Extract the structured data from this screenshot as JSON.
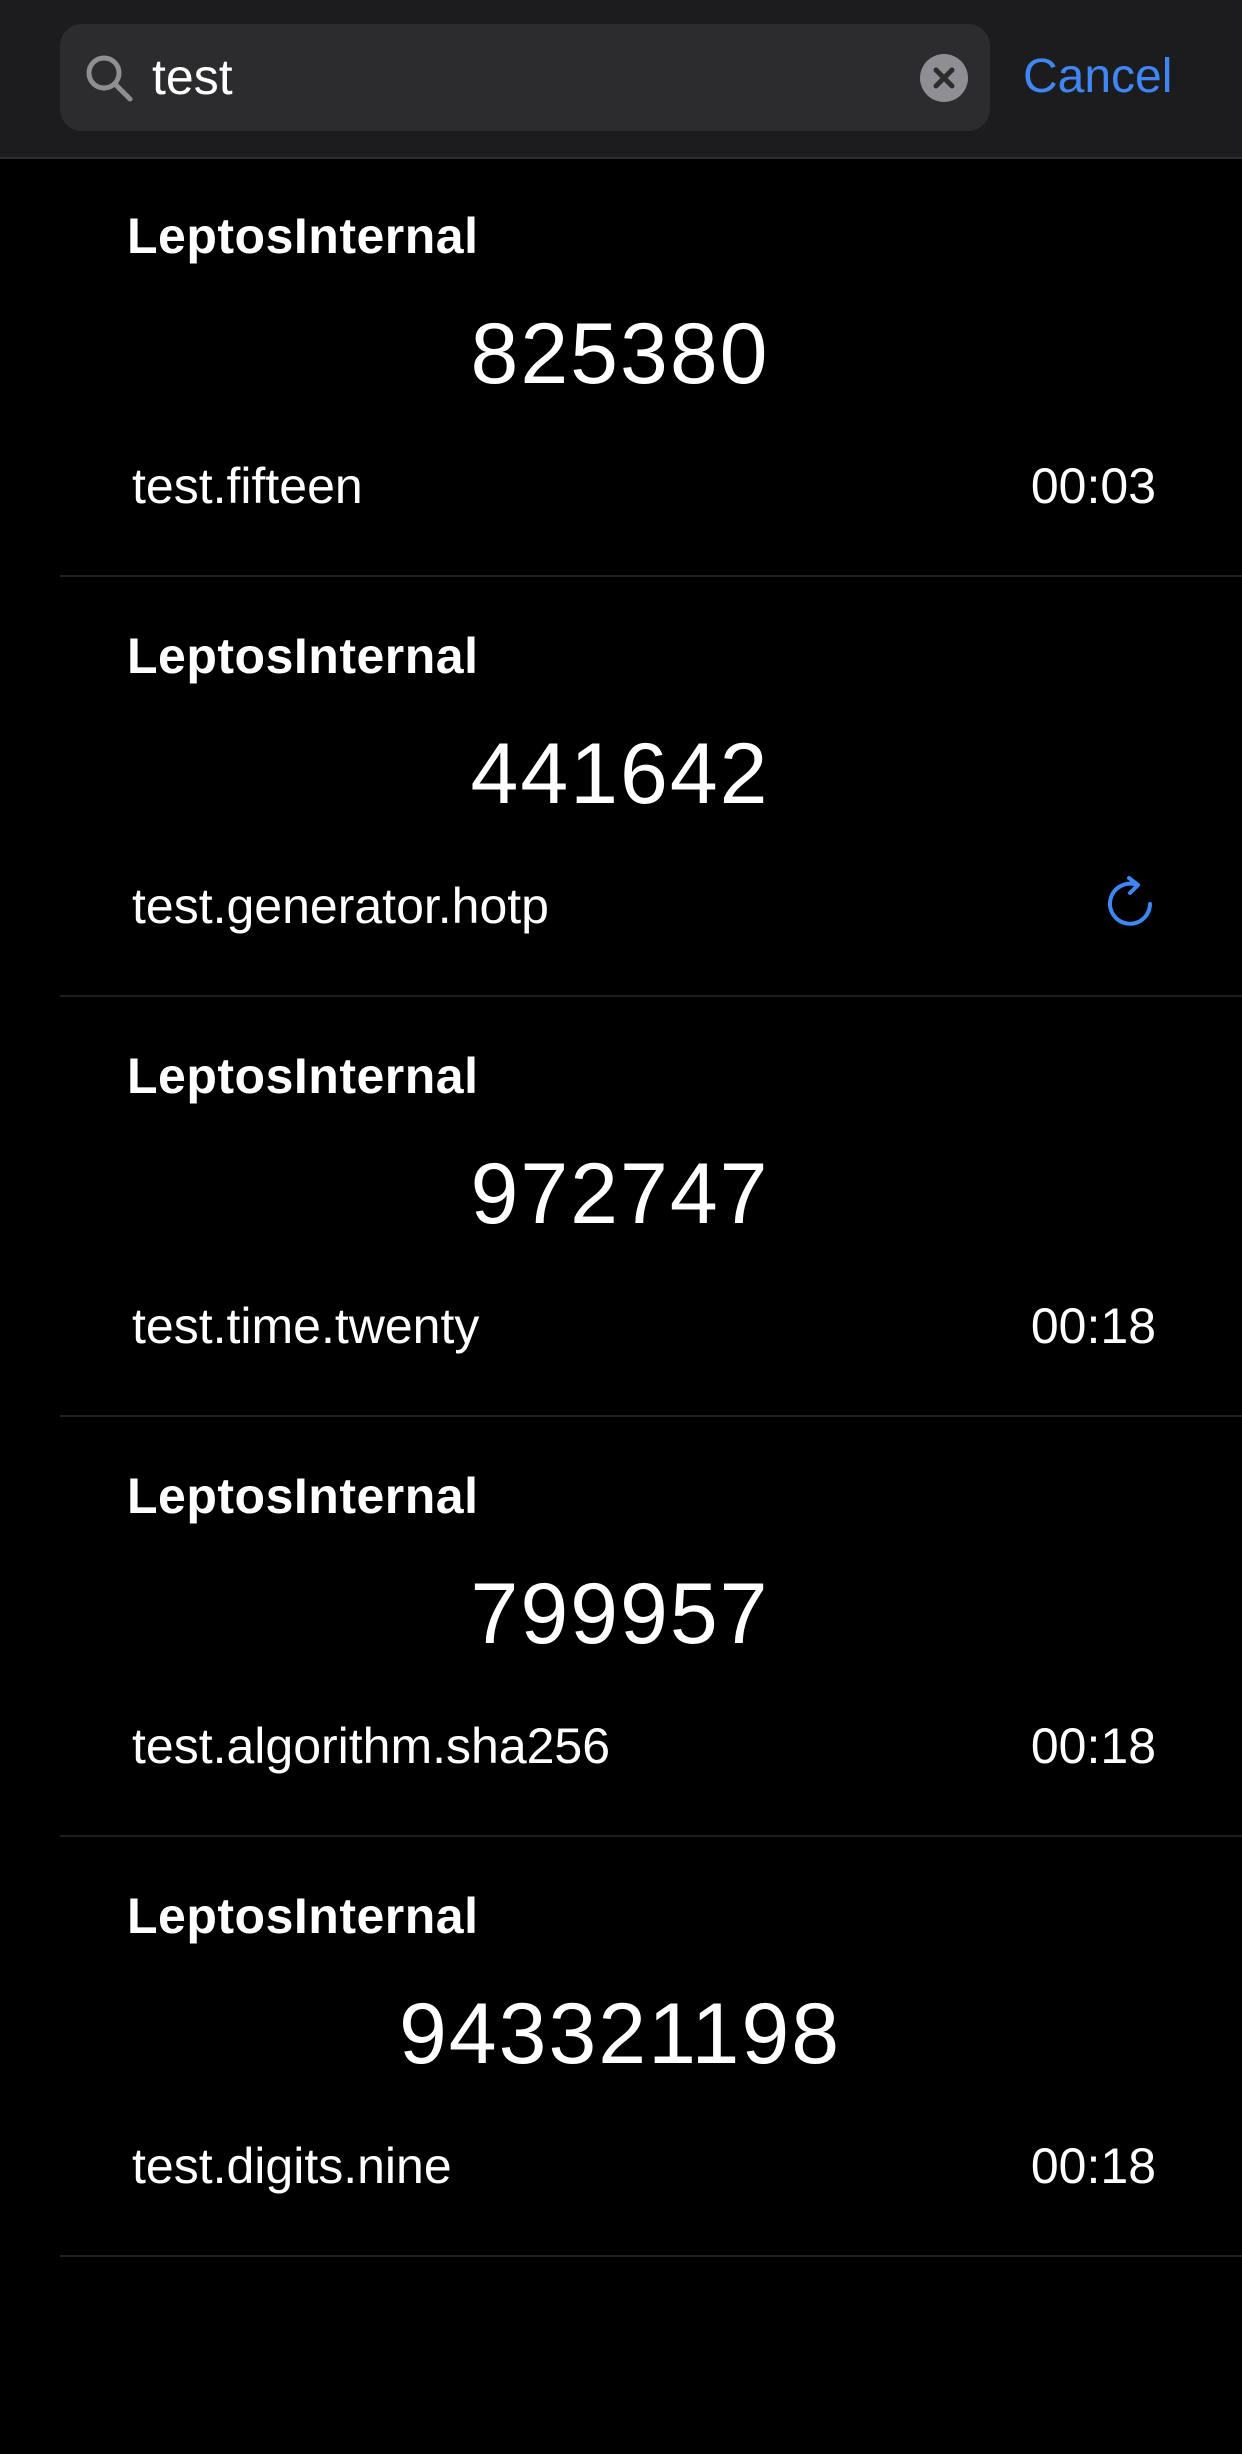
{
  "search": {
    "value": "test",
    "icon": "search-icon",
    "clear_icon": "clear-icon"
  },
  "header": {
    "cancel_label": "Cancel"
  },
  "colors": {
    "accent": "#3f87f5",
    "background": "#000000",
    "search_bar_bg": "#1c1c1e",
    "search_field_bg": "#2c2c2e"
  },
  "results": [
    {
      "issuer": "LeptosInternal",
      "code": "825380",
      "account": "test.fifteen",
      "timer": "00:03"
    },
    {
      "issuer": "LeptosInternal",
      "code": "441642",
      "account": "test.generator.hotp",
      "refresh_icon": "refresh-icon"
    },
    {
      "issuer": "LeptosInternal",
      "code": "972747",
      "account": "test.time.twenty",
      "timer": "00:18"
    },
    {
      "issuer": "LeptosInternal",
      "code": "799957",
      "account": "test.algorithm.sha256",
      "timer": "00:18"
    },
    {
      "issuer": "LeptosInternal",
      "code": "943321198",
      "account": "test.digits.nine",
      "timer": "00:18"
    }
  ]
}
